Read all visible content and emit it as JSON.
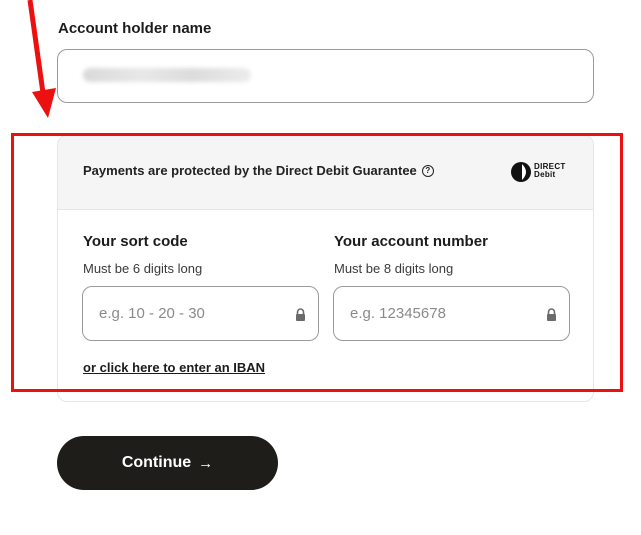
{
  "form": {
    "holder_label": "Account holder name"
  },
  "guarantee": {
    "text": "Payments are protected by the Direct Debit Guarantee",
    "help_symbol": "?",
    "logo_line1": "DIRECT",
    "logo_line2": "Debit"
  },
  "sort_code": {
    "label": "Your sort code",
    "hint": "Must be 6 digits long",
    "placeholder": "e.g. 10 - 20 - 30"
  },
  "account_number": {
    "label": "Your account number",
    "hint": "Must be 8 digits long",
    "placeholder": "e.g. 12345678"
  },
  "iban_link": "or click here to enter an IBAN",
  "continue": {
    "label": "Continue",
    "arrow": "→"
  },
  "icons": [
    "annotation-arrow",
    "help-icon",
    "direct-debit-logo",
    "lock-icon",
    "arrow-right-icon"
  ],
  "colors": {
    "annotation_red": "#ec1010",
    "button_bg": "#1f1d1a",
    "header_bg": "#f5f5f5",
    "border": "#9b9b9b"
  }
}
